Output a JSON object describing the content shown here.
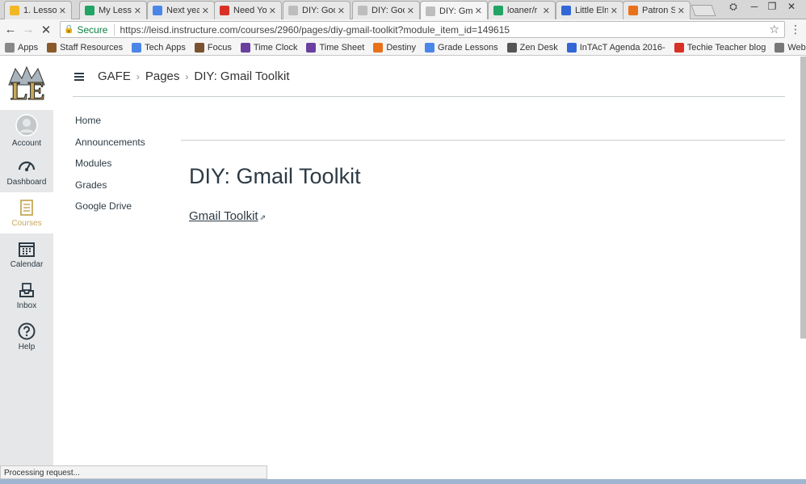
{
  "tabs": [
    {
      "label": "1. Lesso",
      "color": "#f2b824",
      "active": false
    },
    {
      "label": "My Less",
      "color": "#21a464",
      "active": false
    },
    {
      "label": "Next yea",
      "color": "#4a86e8",
      "active": false
    },
    {
      "label": "Need Yo",
      "color": "#d93025",
      "active": false
    },
    {
      "label": "DIY: Goo",
      "color": "#bdbdbd",
      "active": false
    },
    {
      "label": "DIY: Goo",
      "color": "#bdbdbd",
      "active": false
    },
    {
      "label": "DIY: Gm",
      "color": "#bdbdbd",
      "active": true
    },
    {
      "label": "loaner/r",
      "color": "#21a464",
      "active": false
    },
    {
      "label": "Little Eln",
      "color": "#3367d6",
      "active": false
    },
    {
      "label": "Patron S",
      "color": "#e8711a",
      "active": false
    }
  ],
  "toolbar": {
    "secure_label": "Secure",
    "url": "https://leisd.instructure.com/courses/2960/pages/diy-gmail-toolkit?module_item_id=149615"
  },
  "bookmarks": [
    {
      "label": "Apps",
      "color": "#888"
    },
    {
      "label": "Staff Resources",
      "color": "#8a5a2b"
    },
    {
      "label": "Tech Apps",
      "color": "#4a86e8"
    },
    {
      "label": "Focus",
      "color": "#7a5230"
    },
    {
      "label": "Time Clock",
      "color": "#6a3fa0"
    },
    {
      "label": "Time Sheet",
      "color": "#6a3fa0"
    },
    {
      "label": "Destiny",
      "color": "#e8711a"
    },
    {
      "label": "Grade Lessons",
      "color": "#4a86e8"
    },
    {
      "label": "Zen Desk",
      "color": "#555"
    },
    {
      "label": "InTAcT Agenda 2016-",
      "color": "#3367d6"
    },
    {
      "label": "Techie Teacher blog",
      "color": "#d93025"
    },
    {
      "label": "WebEase",
      "color": "#777"
    }
  ],
  "global_nav": {
    "items": [
      {
        "label": "Account",
        "icon": "account-icon",
        "active": false
      },
      {
        "label": "Dashboard",
        "icon": "dashboard-icon",
        "active": false
      },
      {
        "label": "Courses",
        "icon": "courses-icon",
        "active": true
      },
      {
        "label": "Calendar",
        "icon": "calendar-icon",
        "active": false
      },
      {
        "label": "Inbox",
        "icon": "inbox-icon",
        "active": false
      },
      {
        "label": "Help",
        "icon": "help-icon",
        "active": false
      }
    ]
  },
  "breadcrumb": {
    "course": "GAFE",
    "section": "Pages",
    "page": "DIY: Gmail Toolkit"
  },
  "course_nav": [
    "Home",
    "Announcements",
    "Modules",
    "Grades",
    "Google Drive"
  ],
  "content": {
    "title": "DIY: Gmail Toolkit",
    "link_text": "Gmail Toolkit"
  },
  "status_text": "Processing request...",
  "colors": {
    "accent": "#c8a85a",
    "text": "#2d3b45"
  }
}
